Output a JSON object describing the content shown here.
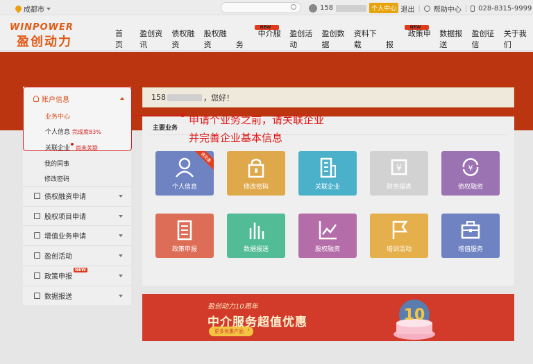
{
  "topbar": {
    "city": "成都市",
    "user_prefix": "158",
    "user_badge": "个人中心",
    "logout": "退出",
    "help": "帮助中心",
    "phone": "028-8315-9999"
  },
  "logo": {
    "en": "WINPOWER",
    "cn": "盈创动力"
  },
  "nav": {
    "items": [
      "首页",
      "盈创资讯",
      "债权融资",
      "股权融资",
      "中介服务",
      "盈创活动",
      "盈创数据",
      "资料下载",
      "政策申报",
      "数据报送",
      "盈创征信",
      "关于我们"
    ],
    "new_tag": "NEW"
  },
  "greeting": {
    "prefix": "158",
    "suffix": "，您好！"
  },
  "sidebar": {
    "account_title": "账户信息",
    "items": [
      {
        "label": "业务中心",
        "active": true
      },
      {
        "label": "个人信息",
        "note": "完成度83%"
      },
      {
        "label": "关联企业",
        "note": "尚未关联"
      }
    ],
    "sub_items": [
      "我的同事",
      "修改密码"
    ],
    "sections": [
      "债权融资申请",
      "股权项目申请",
      "增值业务申请",
      "盈创活动",
      "政策申报",
      "数据报送"
    ]
  },
  "panel": {
    "title": "主要业务",
    "corner": "请完善"
  },
  "tiles": [
    {
      "label": "个人信息",
      "icon": "person-icon",
      "color": "#6f83c3"
    },
    {
      "label": "修改密码",
      "icon": "lock-icon",
      "color": "#dfa84a"
    },
    {
      "label": "关联企业",
      "icon": "building-icon",
      "color": "#4bb0c9"
    },
    {
      "label": "财务报表",
      "icon": "report-icon",
      "color": "#d2d2d2"
    },
    {
      "label": "债权融资",
      "icon": "yen-cycle-icon",
      "color": "#9b72b2"
    },
    {
      "label": "政策申报",
      "icon": "document-icon",
      "color": "#de6d57"
    },
    {
      "label": "数据报送",
      "icon": "bar-chart-icon",
      "color": "#52bc96"
    },
    {
      "label": "股权融资",
      "icon": "line-chart-icon",
      "color": "#b46da8"
    },
    {
      "label": "培训活动",
      "icon": "flag-icon",
      "color": "#e5b04b"
    },
    {
      "label": "增值服务",
      "icon": "briefcase-icon",
      "color": "#6f83c3"
    }
  ],
  "banner": {
    "line1": "盈创动力10周年",
    "line2": "中介服务超值优惠",
    "cta": "更多优惠产品",
    "badge": "10"
  },
  "annotation": {
    "line1": "申请个业务之前，请关联企业",
    "line2": "并完善企业基本信息"
  },
  "colors": {
    "accent": "#d4501c",
    "band": "#bb3610",
    "annotation": "#e01515"
  }
}
